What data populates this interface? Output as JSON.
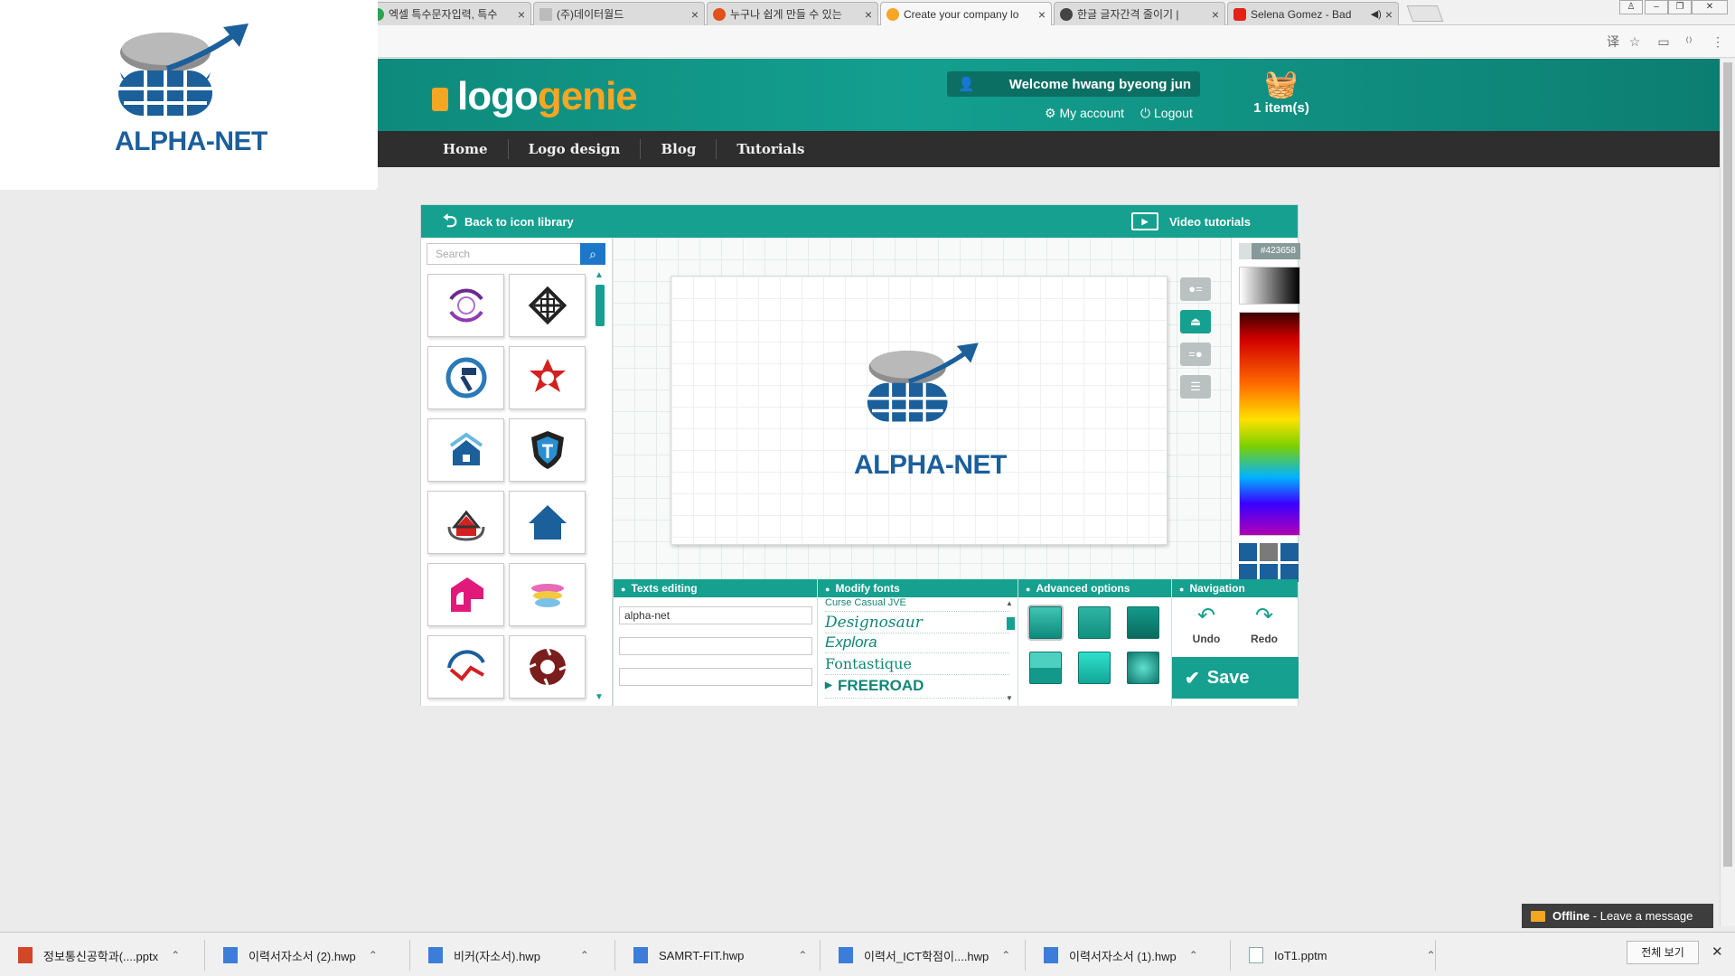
{
  "browser": {
    "tabs": [
      {
        "title": "엑셀 특수문자입력, 특수",
        "color": "#2ea44f"
      },
      {
        "title": "(주)데이터월드",
        "color": "#9e9e9e"
      },
      {
        "title": "누구나 쉽게 만들 수 있는",
        "color": "#e2501c"
      },
      {
        "title": "Create your company lo",
        "color": "#f5a623"
      },
      {
        "title": "한글 글자간격 줄이기 |",
        "color": "#444444"
      },
      {
        "title": "Selena Gomez - Bad",
        "color": "#e62117"
      }
    ],
    "tab_close": "×"
  },
  "overlay": {
    "logo_text": "ALPHA-NET"
  },
  "site": {
    "brand_part1": "logo",
    "brand_part2": "genie",
    "welcome": "Welcome hwang byeong jun",
    "my_account": "My account",
    "logout": "Logout",
    "cart_count": "1 item(s)",
    "nav": [
      "Home",
      "Logo design",
      "Blog",
      "Tutorials"
    ]
  },
  "editor": {
    "back_label": "Back to icon library",
    "video_label": "Video tutorials",
    "search_placeholder": "Search",
    "logo_text": "ALPHA-NET",
    "hex_value": "#423658",
    "panels": {
      "texts": "Texts editing",
      "fonts": "Modify fonts",
      "advanced": "Advanced options",
      "navigation": "Navigation"
    },
    "text_fields": [
      "alpha-net",
      "",
      ""
    ],
    "fonts": [
      "Curse Casual JVE",
      "Designosaur",
      "Explora",
      "Fontastique",
      "FREEROAD"
    ],
    "undo": "Undo",
    "redo": "Redo",
    "save": "Save"
  },
  "chat": {
    "status": "Offline",
    "message": " - Leave a message"
  },
  "downloads": {
    "items": [
      "정보통신공학과(....pptx",
      "이력서자소서 (2).hwp",
      "비커(자소서).hwp",
      "SAMRT-FIT.hwp",
      "이력서_ICT학점이....hwp",
      "이력서자소서 (1).hwp",
      "IoT1.pptm"
    ],
    "show_all": "전체 보기"
  },
  "colors": {
    "accent": "#16a08f",
    "brand_orange": "#f5a623",
    "logo_blue": "#1b5f9b",
    "nav_dark": "#2e2e2e"
  }
}
